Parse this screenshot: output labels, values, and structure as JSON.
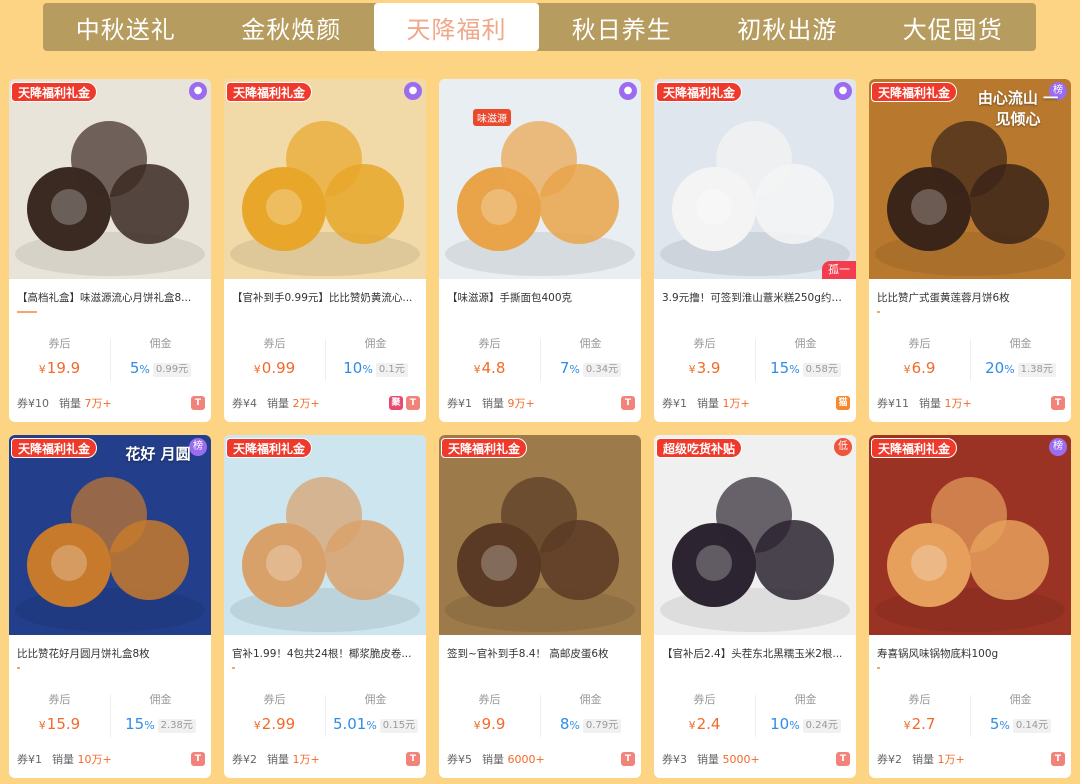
{
  "tabs": [
    {
      "label": "中秋送礼",
      "active": false
    },
    {
      "label": "金秋焕颜",
      "active": false
    },
    {
      "label": "天降福利",
      "active": true
    },
    {
      "label": "秋日养生",
      "active": false
    },
    {
      "label": "初秋出游",
      "active": false
    },
    {
      "label": "大促囤货",
      "active": false
    }
  ],
  "labels": {
    "after_coupon": "券后",
    "commission": "佣金",
    "coupon_prefix": "券",
    "sales_prefix": "销量",
    "currency": "¥"
  },
  "products": [
    {
      "tag": "天降福利礼金",
      "badge": "coin",
      "title": "【高档礼盒】味滋源流心月饼礼盒8...",
      "price": "19.9",
      "rate": "5",
      "rate_amt": "0.99元",
      "coupon": "¥10",
      "sales": "7万+",
      "icons": [
        "T"
      ],
      "art": "#e9e4da",
      "art2": "#3a2a22",
      "underline": "line"
    },
    {
      "tag": "天降福利礼金",
      "badge": "coin",
      "title": "【官补到手0.99元】比比赞奶黄流心...",
      "price": "0.99",
      "rate": "10",
      "rate_amt": "0.1元",
      "coupon": "¥4",
      "sales": "2万+",
      "icons": [
        "聚",
        "T"
      ],
      "art": "#f1d9a8",
      "art2": "#e8a72a",
      "underline": "none"
    },
    {
      "tag": "",
      "badge": "coin",
      "title": "【味滋源】手撕面包400克",
      "price": "4.8",
      "rate": "7",
      "rate_amt": "0.34元",
      "coupon": "¥1",
      "sales": "9万+",
      "icons": [
        "T"
      ],
      "art": "#e9eef2",
      "art2": "#e9a44a",
      "underline": "none",
      "brand": "味滋源"
    },
    {
      "tag": "天降福利礼金",
      "badge": "coin",
      "title": "3.9元撸！可签到淮山薏米糕250g约1...",
      "price": "3.9",
      "rate": "15",
      "rate_amt": "0.58元",
      "coupon": "¥1",
      "sales": "1万+",
      "icons": [
        "猫"
      ],
      "art": "#dfe6ee",
      "art2": "#f4f4f4",
      "underline": "none",
      "corner": "孤一"
    },
    {
      "tag": "天降福利礼金",
      "badge": "榜",
      "title": "比比赞广式蛋黄莲蓉月饼6枚",
      "price": "6.9",
      "rate": "20",
      "rate_amt": "1.38元",
      "coupon": "¥11",
      "sales": "1万+",
      "icons": [
        "T"
      ],
      "art": "#b8792f",
      "art2": "#3b2418",
      "underline": "dot",
      "overlay": "由心流山 一见倾心"
    },
    {
      "tag": "天降福利礼金",
      "badge": "榜",
      "title": "比比赞花好月圆月饼礼盒8枚",
      "price": "15.9",
      "rate": "15",
      "rate_amt": "2.38元",
      "coupon": "¥1",
      "sales": "10万+",
      "icons": [
        "T"
      ],
      "art": "#233f8c",
      "art2": "#c77a2c",
      "underline": "dot",
      "overlay": "花好 月圆"
    },
    {
      "tag": "天降福利礼金",
      "badge": "",
      "title": "官补1.99！4包共24根！椰浆脆皮卷...",
      "price": "2.99",
      "rate": "5.01",
      "rate_amt": "0.15元",
      "coupon": "¥2",
      "sales": "1万+",
      "icons": [
        "T"
      ],
      "art": "#cde5ee",
      "art2": "#d9a16a",
      "underline": "dot"
    },
    {
      "tag": "天降福利礼金",
      "badge": "",
      "title": "签到~官补到手8.4！ 高邮皮蛋6枚",
      "price": "9.9",
      "rate": "8",
      "rate_amt": "0.79元",
      "coupon": "¥5",
      "sales": "6000+",
      "icons": [
        "T"
      ],
      "art": "#9c7a4a",
      "art2": "#5a3a24",
      "underline": "none"
    },
    {
      "tag": "超级吃货补贴",
      "badge": "低",
      "title": "【官补后2.4】头茬东北黑糯玉米2根...",
      "price": "2.4",
      "rate": "10",
      "rate_amt": "0.24元",
      "coupon": "¥3",
      "sales": "5000+",
      "icons": [
        "T"
      ],
      "art": "#f0f0f0",
      "art2": "#2c2430",
      "underline": "none"
    },
    {
      "tag": "天降福利礼金",
      "badge": "榜",
      "title": "寿喜锅风味锅物底料100g",
      "price": "2.7",
      "rate": "5",
      "rate_amt": "0.14元",
      "coupon": "¥2",
      "sales": "1万+",
      "icons": [
        "T"
      ],
      "art": "#9b3324",
      "art2": "#e6a05c",
      "underline": "dot"
    }
  ]
}
